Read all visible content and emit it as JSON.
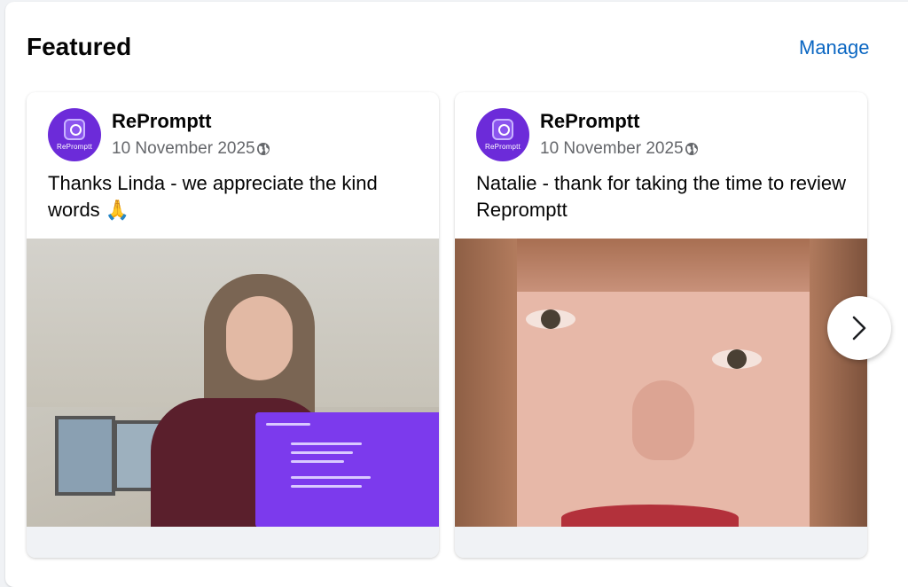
{
  "section": {
    "title": "Featured",
    "manage_label": "Manage"
  },
  "cards": [
    {
      "page_name": "RePromptt",
      "date": "10 November 2025",
      "text": "Thanks Linda - we appreciate the kind words",
      "emoji": "🙏",
      "avatar_text": "RePromptt"
    },
    {
      "page_name": "RePromptt",
      "date": "10 November 2025",
      "text": "Natalie - thank for taking the time to review Repromptt",
      "avatar_text": "RePromptt"
    }
  ],
  "icons": {
    "privacy": "globe-icon",
    "next": "chevron-right-icon"
  },
  "colors": {
    "brand_purple": "#6c2bd9",
    "link_blue": "#0a66c2"
  }
}
